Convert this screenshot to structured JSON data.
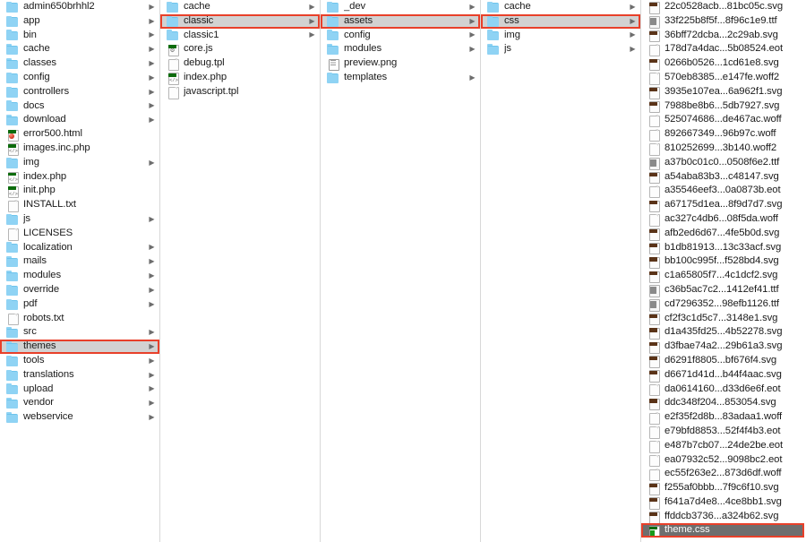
{
  "window": {
    "title": "Finder Column View",
    "selection_outline_color": "#e8402a",
    "selected_row_bg": "#d2d2d2",
    "active_selected_row_bg": "#6e6e6e",
    "folder_icon_color": "#8fd3f4"
  },
  "columns": [
    {
      "name": "root",
      "items": [
        {
          "label": "admin650brhhl2",
          "icon": "folder-icon",
          "arrow": true,
          "state": "normal"
        },
        {
          "label": "app",
          "icon": "folder-icon",
          "arrow": true,
          "state": "normal"
        },
        {
          "label": "bin",
          "icon": "folder-icon",
          "arrow": true,
          "state": "normal"
        },
        {
          "label": "cache",
          "icon": "folder-icon",
          "arrow": true,
          "state": "normal"
        },
        {
          "label": "classes",
          "icon": "folder-icon",
          "arrow": true,
          "state": "normal"
        },
        {
          "label": "config",
          "icon": "folder-icon",
          "arrow": true,
          "state": "normal"
        },
        {
          "label": "controllers",
          "icon": "folder-icon",
          "arrow": true,
          "state": "normal"
        },
        {
          "label": "docs",
          "icon": "folder-icon",
          "arrow": true,
          "state": "normal"
        },
        {
          "label": "download",
          "icon": "folder-icon",
          "arrow": true,
          "state": "normal"
        },
        {
          "label": "error500.html",
          "icon": "html-file-icon",
          "arrow": false,
          "state": "normal"
        },
        {
          "label": "images.inc.php",
          "icon": "php-file-icon",
          "arrow": false,
          "state": "normal"
        },
        {
          "label": "img",
          "icon": "folder-icon",
          "arrow": true,
          "state": "normal"
        },
        {
          "label": "index.php",
          "icon": "php-file-icon",
          "arrow": false,
          "state": "normal"
        },
        {
          "label": "init.php",
          "icon": "php-file-icon",
          "arrow": false,
          "state": "normal"
        },
        {
          "label": "INSTALL.txt",
          "icon": "doc-file-icon",
          "arrow": false,
          "state": "normal"
        },
        {
          "label": "js",
          "icon": "folder-icon",
          "arrow": true,
          "state": "normal"
        },
        {
          "label": "LICENSES",
          "icon": "doc-file-icon",
          "arrow": false,
          "state": "normal"
        },
        {
          "label": "localization",
          "icon": "folder-icon",
          "arrow": true,
          "state": "normal"
        },
        {
          "label": "mails",
          "icon": "folder-icon",
          "arrow": true,
          "state": "normal"
        },
        {
          "label": "modules",
          "icon": "folder-icon",
          "arrow": true,
          "state": "normal"
        },
        {
          "label": "override",
          "icon": "folder-icon",
          "arrow": true,
          "state": "normal"
        },
        {
          "label": "pdf",
          "icon": "folder-icon",
          "arrow": true,
          "state": "normal"
        },
        {
          "label": "robots.txt",
          "icon": "doc-file-icon",
          "arrow": false,
          "state": "normal"
        },
        {
          "label": "src",
          "icon": "folder-icon",
          "arrow": true,
          "state": "normal"
        },
        {
          "label": "themes",
          "icon": "folder-icon",
          "arrow": true,
          "state": "selected-outlined"
        },
        {
          "label": "tools",
          "icon": "folder-icon",
          "arrow": true,
          "state": "normal"
        },
        {
          "label": "translations",
          "icon": "folder-icon",
          "arrow": true,
          "state": "normal"
        },
        {
          "label": "upload",
          "icon": "folder-icon",
          "arrow": true,
          "state": "normal"
        },
        {
          "label": "vendor",
          "icon": "folder-icon",
          "arrow": true,
          "state": "normal"
        },
        {
          "label": "webservice",
          "icon": "folder-icon",
          "arrow": true,
          "state": "normal"
        }
      ]
    },
    {
      "name": "themes",
      "items": [
        {
          "label": "cache",
          "icon": "folder-icon",
          "arrow": true,
          "state": "normal"
        },
        {
          "label": "classic",
          "icon": "folder-icon",
          "arrow": true,
          "state": "selected-outlined"
        },
        {
          "label": "classic1",
          "icon": "folder-icon",
          "arrow": true,
          "state": "normal"
        },
        {
          "label": "core.js",
          "icon": "js-file-icon",
          "arrow": false,
          "state": "normal"
        },
        {
          "label": "debug.tpl",
          "icon": "doc-file-icon",
          "arrow": false,
          "state": "normal"
        },
        {
          "label": "index.php",
          "icon": "php-file-icon",
          "arrow": false,
          "state": "normal"
        },
        {
          "label": "javascript.tpl",
          "icon": "doc-file-icon",
          "arrow": false,
          "state": "normal"
        }
      ]
    },
    {
      "name": "classic",
      "items": [
        {
          "label": "_dev",
          "icon": "folder-icon",
          "arrow": true,
          "state": "normal"
        },
        {
          "label": "assets",
          "icon": "folder-icon",
          "arrow": true,
          "state": "selected-outlined"
        },
        {
          "label": "config",
          "icon": "folder-icon",
          "arrow": true,
          "state": "normal"
        },
        {
          "label": "modules",
          "icon": "folder-icon",
          "arrow": true,
          "state": "normal"
        },
        {
          "label": "preview.png",
          "icon": "png-file-icon",
          "arrow": false,
          "state": "normal"
        },
        {
          "label": "templates",
          "icon": "folder-icon",
          "arrow": true,
          "state": "normal"
        }
      ]
    },
    {
      "name": "assets",
      "items": [
        {
          "label": "cache",
          "icon": "folder-icon",
          "arrow": true,
          "state": "normal"
        },
        {
          "label": "css",
          "icon": "folder-icon",
          "arrow": true,
          "state": "selected-outlined"
        },
        {
          "label": "img",
          "icon": "folder-icon",
          "arrow": true,
          "state": "normal"
        },
        {
          "label": "js",
          "icon": "folder-icon",
          "arrow": true,
          "state": "normal"
        }
      ]
    },
    {
      "name": "css",
      "items": [
        {
          "label": "22c0528acb...81bc05c.svg",
          "icon": "svg-file-icon",
          "arrow": false,
          "state": "normal"
        },
        {
          "label": "33f225b8f5f...8f96c1e9.ttf",
          "icon": "ttf-file-icon",
          "arrow": false,
          "state": "normal"
        },
        {
          "label": "36bff72dcba...2c29ab.svg",
          "icon": "svg-file-icon",
          "arrow": false,
          "state": "normal"
        },
        {
          "label": "178d7a4dac...5b08524.eot",
          "icon": "doc-file-icon",
          "arrow": false,
          "state": "normal"
        },
        {
          "label": "0266b0526...1cd61e8.svg",
          "icon": "svg-file-icon",
          "arrow": false,
          "state": "normal"
        },
        {
          "label": "570eb8385...e147fe.woff2",
          "icon": "doc-file-icon",
          "arrow": false,
          "state": "normal"
        },
        {
          "label": "3935e107ea...6a962f1.svg",
          "icon": "svg-file-icon",
          "arrow": false,
          "state": "normal"
        },
        {
          "label": "7988be8b6...5db7927.svg",
          "icon": "svg-file-icon",
          "arrow": false,
          "state": "normal"
        },
        {
          "label": "525074686...de467ac.woff",
          "icon": "doc-file-icon",
          "arrow": false,
          "state": "normal"
        },
        {
          "label": "892667349...96b97c.woff",
          "icon": "doc-file-icon",
          "arrow": false,
          "state": "normal"
        },
        {
          "label": "810252699...3b140.woff2",
          "icon": "doc-file-icon",
          "arrow": false,
          "state": "normal"
        },
        {
          "label": "a37b0c01c0...0508f6e2.ttf",
          "icon": "ttf-file-icon",
          "arrow": false,
          "state": "normal"
        },
        {
          "label": "a54aba83b3...c48147.svg",
          "icon": "svg-file-icon",
          "arrow": false,
          "state": "normal"
        },
        {
          "label": "a35546eef3...0a0873b.eot",
          "icon": "doc-file-icon",
          "arrow": false,
          "state": "normal"
        },
        {
          "label": "a67175d1ea...8f9d7d7.svg",
          "icon": "svg-file-icon",
          "arrow": false,
          "state": "normal"
        },
        {
          "label": "ac327c4db6...08f5da.woff",
          "icon": "doc-file-icon",
          "arrow": false,
          "state": "normal"
        },
        {
          "label": "afb2ed6d67...4fe5b0d.svg",
          "icon": "svg-file-icon",
          "arrow": false,
          "state": "normal"
        },
        {
          "label": "b1db81913...13c33acf.svg",
          "icon": "svg-file-icon",
          "arrow": false,
          "state": "normal"
        },
        {
          "label": "bb100c995f...f528bd4.svg",
          "icon": "svg-file-icon",
          "arrow": false,
          "state": "normal"
        },
        {
          "label": "c1a65805f7...4c1dcf2.svg",
          "icon": "svg-file-icon",
          "arrow": false,
          "state": "normal"
        },
        {
          "label": "c36b5ac7c2...1412ef41.ttf",
          "icon": "ttf-file-icon",
          "arrow": false,
          "state": "normal"
        },
        {
          "label": "cd7296352...98efb1126.ttf",
          "icon": "ttf-file-icon",
          "arrow": false,
          "state": "normal"
        },
        {
          "label": "cf2f3c1d5c7...3148e1.svg",
          "icon": "svg-file-icon",
          "arrow": false,
          "state": "normal"
        },
        {
          "label": "d1a435fd25...4b52278.svg",
          "icon": "svg-file-icon",
          "arrow": false,
          "state": "normal"
        },
        {
          "label": "d3fbae74a2...29b61a3.svg",
          "icon": "svg-file-icon",
          "arrow": false,
          "state": "normal"
        },
        {
          "label": "d6291f8805...bf676f4.svg",
          "icon": "svg-file-icon",
          "arrow": false,
          "state": "normal"
        },
        {
          "label": "d6671d41d...b44f4aac.svg",
          "icon": "svg-file-icon",
          "arrow": false,
          "state": "normal"
        },
        {
          "label": "da0614160...d33d6e6f.eot",
          "icon": "doc-file-icon",
          "arrow": false,
          "state": "normal"
        },
        {
          "label": "ddc348f204...853054.svg",
          "icon": "svg-file-icon",
          "arrow": false,
          "state": "normal"
        },
        {
          "label": "e2f35f2d8b...83adaa1.woff",
          "icon": "doc-file-icon",
          "arrow": false,
          "state": "normal"
        },
        {
          "label": "e79bfd8853...52f4f4b3.eot",
          "icon": "doc-file-icon",
          "arrow": false,
          "state": "normal"
        },
        {
          "label": "e487b7cb07...24de2be.eot",
          "icon": "doc-file-icon",
          "arrow": false,
          "state": "normal"
        },
        {
          "label": "ea07932c52...9098bc2.eot",
          "icon": "doc-file-icon",
          "arrow": false,
          "state": "normal"
        },
        {
          "label": "ec55f263e2...873d6df.woff",
          "icon": "doc-file-icon",
          "arrow": false,
          "state": "normal"
        },
        {
          "label": "f255af0bbb...7f9c6f10.svg",
          "icon": "svg-file-icon",
          "arrow": false,
          "state": "normal"
        },
        {
          "label": "f641a7d4e8...4ce8bb1.svg",
          "icon": "svg-file-icon",
          "arrow": false,
          "state": "normal"
        },
        {
          "label": "ffddcb3736...a324b62.svg",
          "icon": "svg-file-icon",
          "arrow": false,
          "state": "normal"
        },
        {
          "label": "theme.css",
          "icon": "css-file-icon",
          "arrow": false,
          "state": "active-selected-outlined"
        }
      ]
    }
  ]
}
